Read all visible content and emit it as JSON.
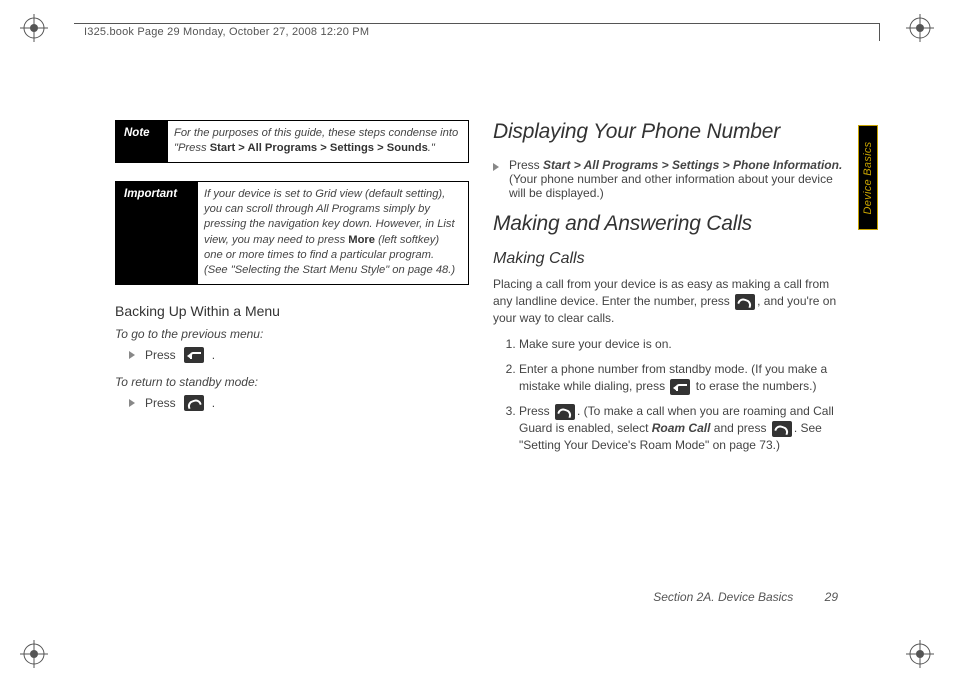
{
  "header": {
    "running": "I325.book  Page 29  Monday, October 27, 2008  12:20 PM"
  },
  "left": {
    "note": {
      "label": "Note",
      "body_prefix": "For the purposes of this guide, these steps condense into \"Press ",
      "body_bold": "Start > All Programs > Settings > Sounds",
      "body_suffix": ".\""
    },
    "important": {
      "label": "Important",
      "body_prefix": "If your device is set to Grid view (default setting), you can scroll through All Programs simply by pressing the navigation key down. However, in List view, you may need to press ",
      "body_bold": "More",
      "body_suffix": " (left softkey) one or more times to find a particular program. (See \"Selecting the Start Menu Style\" on page 48.)"
    },
    "backing_up": {
      "heading": "Backing Up Within a Menu",
      "lead1": "To go to the previous menu:",
      "press1": "Press ",
      "lead2": "To return to standby mode:",
      "press2": "Press "
    }
  },
  "right": {
    "h1": "Displaying Your Phone Number",
    "bullet": {
      "press": "Press ",
      "path": "Start > All Programs > Settings > Phone Information.",
      "rest": " (Your phone number and other information about your device will be displayed.)"
    },
    "h2": "Making and Answering Calls",
    "h3": "Making Calls",
    "para_a": "Placing a call from your device is as easy as making a call from any landline device. Enter the number, press ",
    "para_b": ", and you're on your way to clear calls.",
    "step1": "Make sure your device is on.",
    "step2a": "Enter a phone number from standby mode. (If you make a mistake while dialing, press ",
    "step2b": " to erase the numbers.)",
    "step3a": "Press ",
    "step3b": ". (To make a call when you are roaming and Call Guard is enabled, select ",
    "step3_roam": "Roam Call",
    "step3c": " and press ",
    "step3d": ". See \"Setting Your Device's Roam Mode\" on page 73.)"
  },
  "sidetab": "Device Basics",
  "footer": {
    "section": "Section 2A. Device Basics",
    "page": "29"
  }
}
